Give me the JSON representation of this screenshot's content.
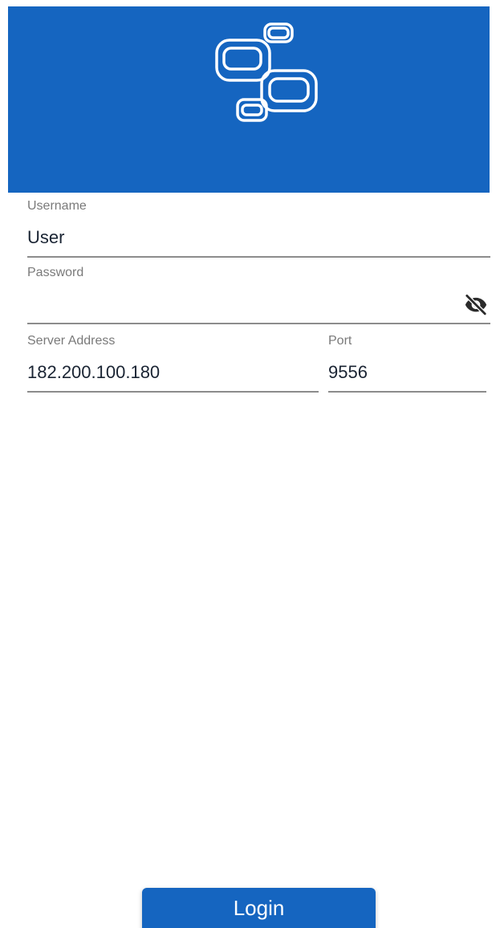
{
  "header": {
    "logo_icon": "linked-rounded-rectangles-logo",
    "background_color": "#1565c0"
  },
  "form": {
    "username": {
      "label": "Username",
      "value": "User"
    },
    "password": {
      "label": "Password",
      "value": "",
      "visibility_icon": "eye-off-icon"
    },
    "server_address": {
      "label": "Server Address",
      "value": "182.200.100.180"
    },
    "port": {
      "label": "Port",
      "value": "9556"
    }
  },
  "actions": {
    "login_label": "Login"
  },
  "colors": {
    "primary": "#1565c0",
    "text": "#1a2433",
    "label": "#7a7a7a"
  }
}
